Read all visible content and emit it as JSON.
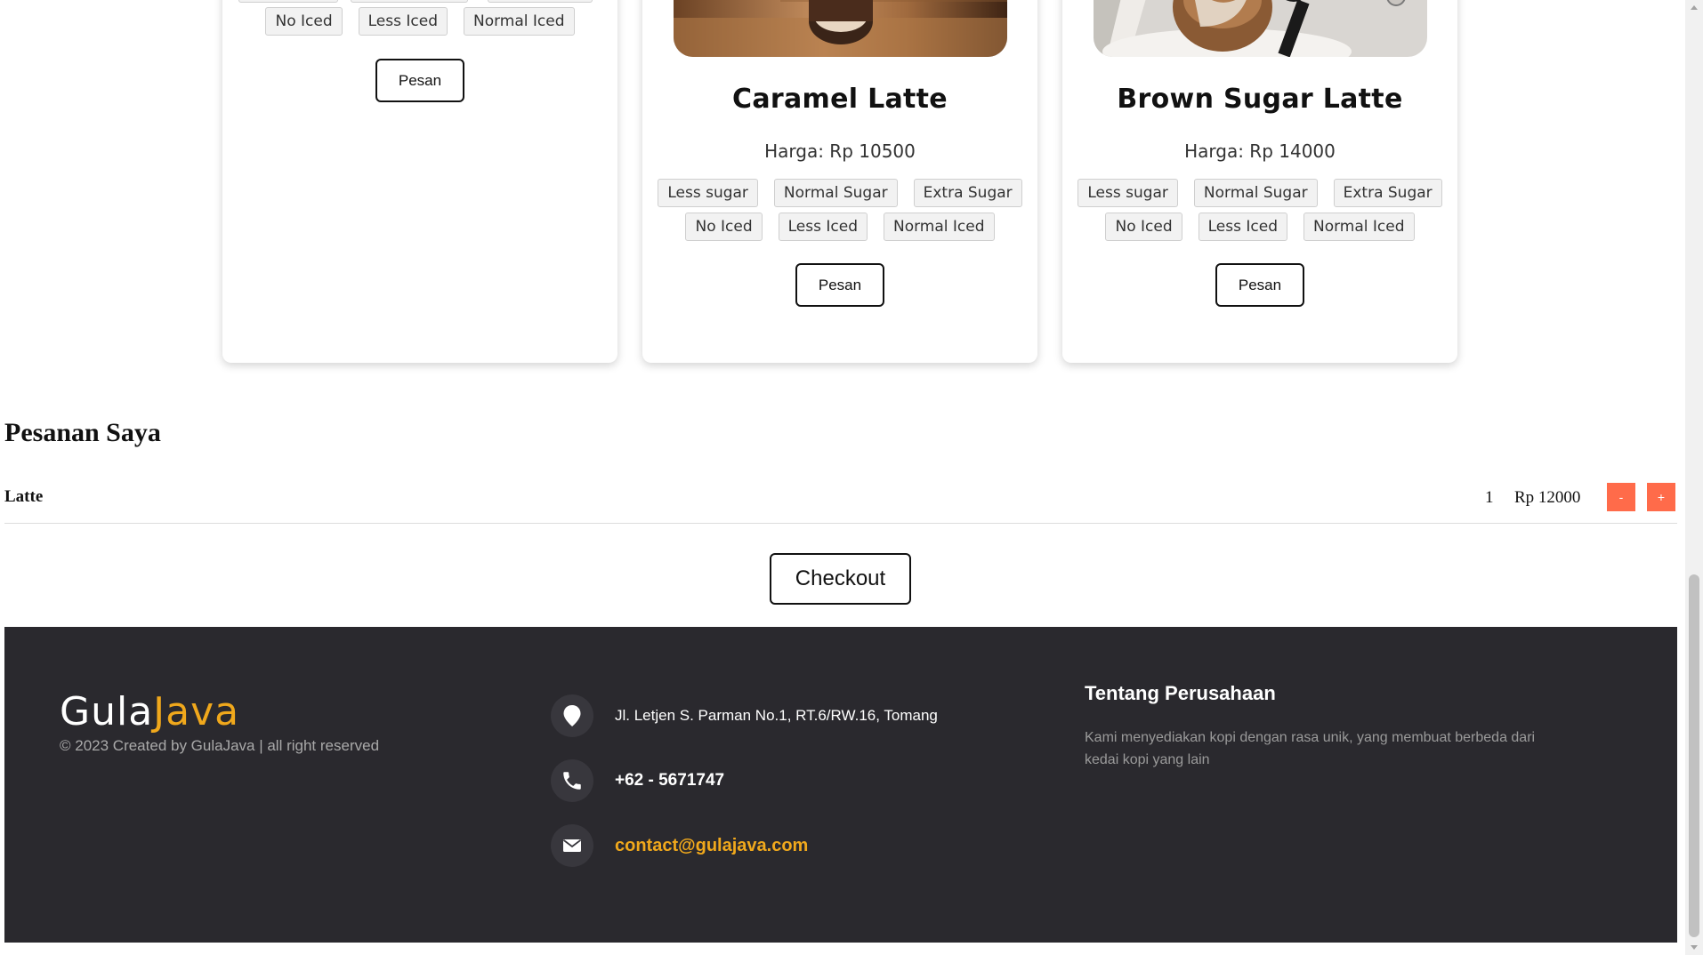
{
  "products": [
    {
      "name": "",
      "price": "",
      "sugar_options": [],
      "ice_options": [
        "No Iced",
        "Less Iced",
        "Normal Iced"
      ],
      "button": "Pesan"
    },
    {
      "name": "Caramel Latte",
      "price": "Harga: Rp 10500",
      "sugar_options": [
        "Less sugar",
        "Normal Sugar",
        "Extra Sugar"
      ],
      "ice_options": [
        "No Iced",
        "Less Iced",
        "Normal Iced"
      ],
      "button": "Pesan"
    },
    {
      "name": "Brown Sugar Latte",
      "price": "Harga: Rp 14000",
      "sugar_options": [
        "Less sugar",
        "Normal Sugar",
        "Extra Sugar"
      ],
      "ice_options": [
        "No Iced",
        "Less Iced",
        "Normal Iced"
      ],
      "button": "Pesan"
    }
  ],
  "orders": {
    "title": "Pesanan Saya",
    "items": [
      {
        "name": "Latte",
        "qty": "1",
        "price": "Rp 12000",
        "minus": "-",
        "plus": "+"
      }
    ],
    "checkout": "Checkout"
  },
  "footer": {
    "logo_part1": "Gula",
    "logo_part2": "Java",
    "copyright": "© 2023 Created by GulaJava | all right reserved",
    "address": "Jl. Letjen S. Parman No.1, RT.6/RW.16, Tomang",
    "phone": "+62 - 5671747",
    "email": "contact@gulajava.com",
    "about_title": "Tentang Perusahaan",
    "about_text": "Kami menyediakan kopi dengan rasa unik, yang membuat berbeda dari kedai kopi yang lain"
  },
  "colors": {
    "accent": "#f0a81c",
    "footer_bg": "#2a292e",
    "qty_button": "#ff6b4a"
  },
  "icons": {
    "address": "map-pin-icon",
    "phone": "phone-icon",
    "email": "envelope-icon"
  }
}
